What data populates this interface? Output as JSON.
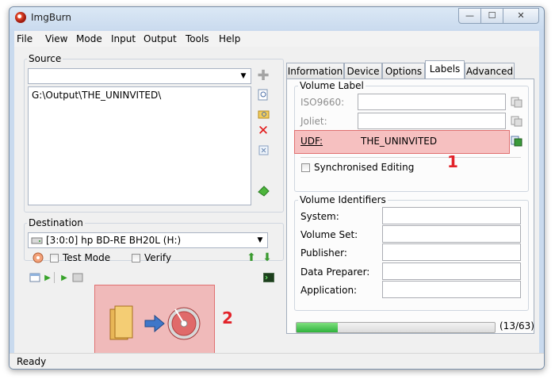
{
  "window": {
    "title": "ImgBurn"
  },
  "menu": [
    "File",
    "View",
    "Mode",
    "Input",
    "Output",
    "Tools",
    "Help"
  ],
  "source": {
    "label": "Source",
    "combo_value": "",
    "list_items": [
      "G:\\Output\\THE_UNINVITED\\"
    ]
  },
  "destination": {
    "label": "Destination",
    "drive": "[3:0:0] hp BD-RE  BH20L (H:)",
    "test_mode": "Test Mode",
    "verify": "Verify"
  },
  "tabs": [
    "Information",
    "Device",
    "Options",
    "Labels",
    "Advanced"
  ],
  "active_tab": "Labels",
  "volume_label": {
    "title": "Volume Label",
    "iso_label": "ISO9660:",
    "joliet_label": "Joliet:",
    "udf_label": "UDF:",
    "iso_value": "",
    "joliet_value": "",
    "udf_value": "THE_UNINVITED",
    "sync_label": "Synchronised Editing"
  },
  "volume_identifiers": {
    "title": "Volume Identifiers",
    "fields": [
      "System:",
      "Volume Set:",
      "Publisher:",
      "Data Preparer:",
      "Application:"
    ]
  },
  "progress": {
    "text": "(13/63)",
    "fraction": 0.206
  },
  "status": "Ready",
  "annotations": {
    "one": "1",
    "two": "2"
  },
  "colors": {
    "highlight": "#f08080",
    "annotation": "#e2232a",
    "progress": "#3cc24a"
  }
}
